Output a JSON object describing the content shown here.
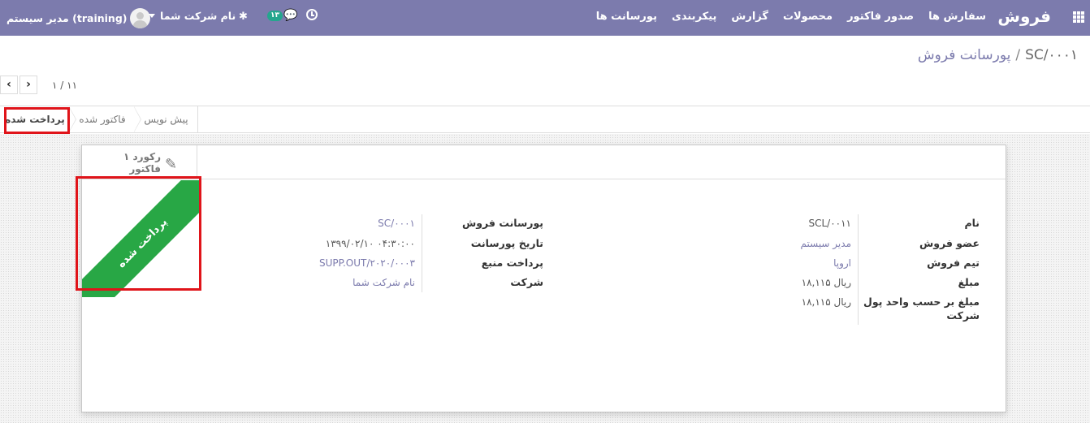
{
  "navbar": {
    "brand": "فروش",
    "menu": [
      "سفارش ها",
      "صدور فاکتور",
      "محصولات",
      "گزارش",
      "پیکربندی",
      "پورسانت ها"
    ],
    "user": "مدیر سیستم (training)",
    "company": "نام شرکت شما",
    "messages_count": "۱۳",
    "icons": [
      "apps-icon",
      "avatar",
      "bug-icon",
      "chat-icon",
      "clock-icon"
    ],
    "color": "#7c7bad"
  },
  "breadcrumb": {
    "parent": "پورسانت فروش",
    "separator": "/",
    "current": "SC/۰۰۰۱"
  },
  "pager": {
    "counter": "۱ / ۱۱"
  },
  "statusbar": {
    "steps": [
      "پیش نویس",
      "فاکتور شده",
      "پرداخت شده"
    ],
    "active": "پرداخت شده"
  },
  "stat_button": {
    "value": "۱ رکورد",
    "text": "فاکتور",
    "icon": "edit-icon"
  },
  "ribbon": {
    "text": "پرداخت شده",
    "color": "#28a745"
  },
  "form": {
    "left_group": [
      {
        "label": "نام",
        "value": "SCL/۰۰۱۱"
      },
      {
        "label": "عضو فروش",
        "value": "مدیر سیستم"
      },
      {
        "label": "تیم فروش",
        "value": "اروپا"
      },
      {
        "label": "مبلغ",
        "value": "۱۸,۱۱۵ ریال"
      },
      {
        "label": "مبلغ بر حسب واحد پول",
        "label2": "شرکت",
        "value": "۱۸,۱۱۵ ریال"
      }
    ],
    "right_group": [
      {
        "label": "پورسانت فروش",
        "value": "SC/۰۰۰۱"
      },
      {
        "label": "تاریخ پورسانت",
        "value": "۱۳۹۹/۰۲/۱۰ ۰۴:۳۰:۰۰"
      },
      {
        "label": "پرداخت منبع",
        "value": "SUPP.OUT/۲۰۲۰/۰۰۰۳"
      },
      {
        "label": "شرکت",
        "value": "نام شرکت شما"
      }
    ]
  },
  "highlight_color": "#e0141a"
}
